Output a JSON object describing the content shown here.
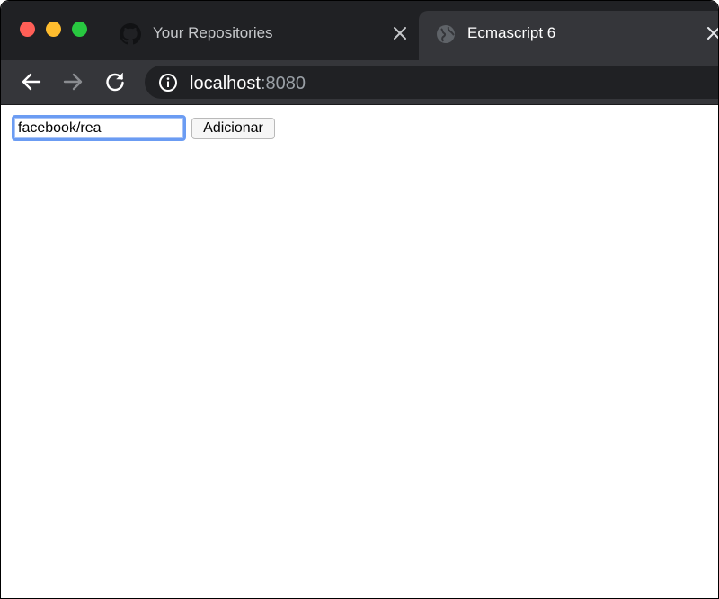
{
  "browser": {
    "tabs": [
      {
        "title": "Your Repositories",
        "icon": "github-icon",
        "active": false
      },
      {
        "title": "Ecmascript 6",
        "icon": "globe-icon",
        "active": true
      }
    ],
    "address_bar": {
      "host": "localhost",
      "port": ":8080",
      "icon": "info-icon"
    },
    "nav": {
      "back_icon": "arrow-left-icon",
      "forward_icon": "arrow-right-icon",
      "reload_icon": "reload-icon"
    }
  },
  "page": {
    "repo_input": {
      "value": "facebook/rea"
    },
    "add_button": {
      "label": "Adicionar"
    }
  },
  "colors": {
    "titlebar": "#202124",
    "toolbar": "#35363a",
    "focus_ring": "#6b9cf3"
  }
}
